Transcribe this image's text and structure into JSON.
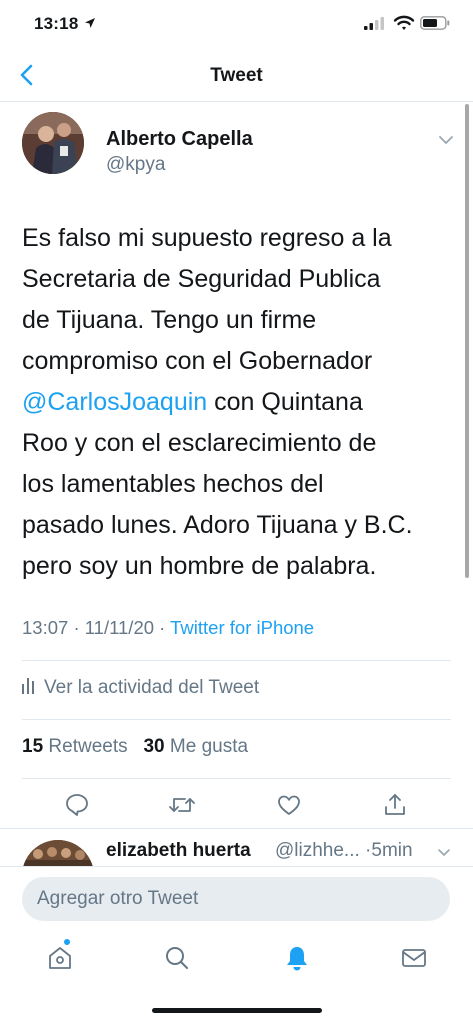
{
  "status_bar": {
    "time": "13:18"
  },
  "nav": {
    "title": "Tweet"
  },
  "tweet": {
    "author_name": "Alberto Capella",
    "author_handle": "@kpya",
    "text_lines": [
      "Es falso mi supuesto regreso a la",
      "Secretaria de Seguridad Publica",
      "de Tijuana. Tengo un firme",
      "compromiso con el Gobernador"
    ],
    "mention": "@CarlosJoaquin",
    "mention_after": " con Quintana",
    "text_lines_after": [
      "Roo y con el esclarecimiento de",
      "los lamentables hechos del",
      "pasado lunes. Adoro Tijuana y B.C.",
      "pero soy un hombre de palabra."
    ],
    "time": "13:07",
    "date": "11/11/20",
    "source": "Twitter for iPhone",
    "activity_label": "Ver la actividad del Tweet",
    "retweets_count": "15",
    "retweets_label": "Retweets",
    "likes_count": "30",
    "likes_label": "Me gusta"
  },
  "reply_preview": {
    "name": "elizabeth huerta",
    "handle_time": "@lizhhe... ·5min"
  },
  "compose": {
    "placeholder": "Agregar otro Tweet"
  },
  "colors": {
    "accent": "#1da1f2",
    "secondary_text": "#657786",
    "divider": "#e1e8ed"
  }
}
